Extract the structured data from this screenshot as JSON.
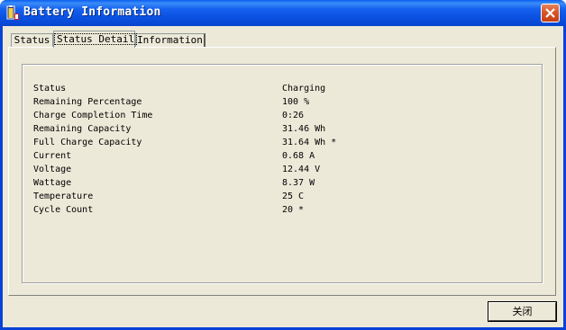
{
  "window": {
    "title": "Battery Information",
    "titlebar_color": "#0a54e4",
    "close_icon": "close-icon",
    "app_icon": "battery-icon"
  },
  "tabs": [
    {
      "label": "Status",
      "active": false
    },
    {
      "label": "Status Detail",
      "active": true
    },
    {
      "label": "Information",
      "active": false
    }
  ],
  "details": [
    {
      "label": "Status",
      "value": "Charging"
    },
    {
      "label": "Remaining Percentage",
      "value": "100 %"
    },
    {
      "label": "Charge Completion Time",
      "value": "0:26"
    },
    {
      "label": "Remaining Capacity",
      "value": "31.46 Wh"
    },
    {
      "label": "Full Charge Capacity",
      "value": "31.64 Wh *"
    },
    {
      "label": "Current",
      "value": "0.68 A"
    },
    {
      "label": "Voltage",
      "value": "12.44 V"
    },
    {
      "label": "Wattage",
      "value": "8.37 W"
    },
    {
      "label": "Temperature",
      "value": "25 C"
    },
    {
      "label": "Cycle Count",
      "value": "20 *"
    }
  ],
  "buttons": {
    "close_label": "关闭"
  }
}
